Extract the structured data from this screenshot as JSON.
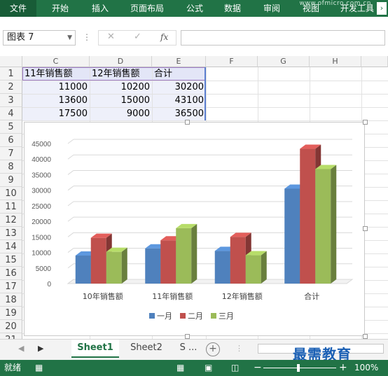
{
  "ribbon": {
    "tabs": [
      "文件",
      "开始",
      "插入",
      "页面布局",
      "公式",
      "数据",
      "审阅",
      "视图",
      "开发工具"
    ],
    "watermark": "www.ofmicro.com.cn",
    "accent": "#217346"
  },
  "formula_bar": {
    "name_box": "图表 7",
    "cancel_label": "✕",
    "enter_label": "✓",
    "fx_label": "fx",
    "formula_value": ""
  },
  "columns": [
    "C",
    "D",
    "E",
    "F",
    "G",
    "H"
  ],
  "rows": [
    "1",
    "2",
    "3",
    "4",
    "5",
    "6",
    "7",
    "8",
    "9",
    "10",
    "11",
    "12",
    "13",
    "14",
    "15",
    "16",
    "17",
    "18",
    "19",
    "20",
    "21"
  ],
  "table": {
    "headers": [
      "11年销售额",
      "12年销售额",
      "合计"
    ],
    "rows": [
      [
        "11000",
        "10200",
        "30200"
      ],
      [
        "13600",
        "15000",
        "43100"
      ],
      [
        "17500",
        "9000",
        "36500"
      ]
    ]
  },
  "chart_data": {
    "type": "bar",
    "style": "3d-clustered-column",
    "categories": [
      "10年销售额",
      "11年销售额",
      "12年销售额",
      "合计"
    ],
    "series": [
      {
        "name": "一月",
        "color": "#4f81bd",
        "values": [
          9000,
          11300,
          10500,
          30500
        ]
      },
      {
        "name": "二月",
        "color": "#c0504d",
        "values": [
          14700,
          13900,
          15000,
          43300
        ]
      },
      {
        "name": "三月",
        "color": "#9bbb59",
        "values": [
          10200,
          17800,
          9100,
          36800
        ]
      }
    ],
    "yticks": [
      "45000",
      "40000",
      "35000",
      "30000",
      "25000",
      "20000",
      "15000",
      "10000",
      "5000",
      "0"
    ],
    "ylim": [
      0,
      45000
    ],
    "legend_position": "bottom",
    "grid": true
  },
  "sheets": {
    "tabs": [
      "Sheet1",
      "Sheet2",
      "S ..."
    ],
    "active": "Sheet1",
    "add_label": "+"
  },
  "brand_text": "最需教育",
  "status": {
    "ready": "就绪",
    "zoom": "100%",
    "minus": "−",
    "plus": "+"
  }
}
